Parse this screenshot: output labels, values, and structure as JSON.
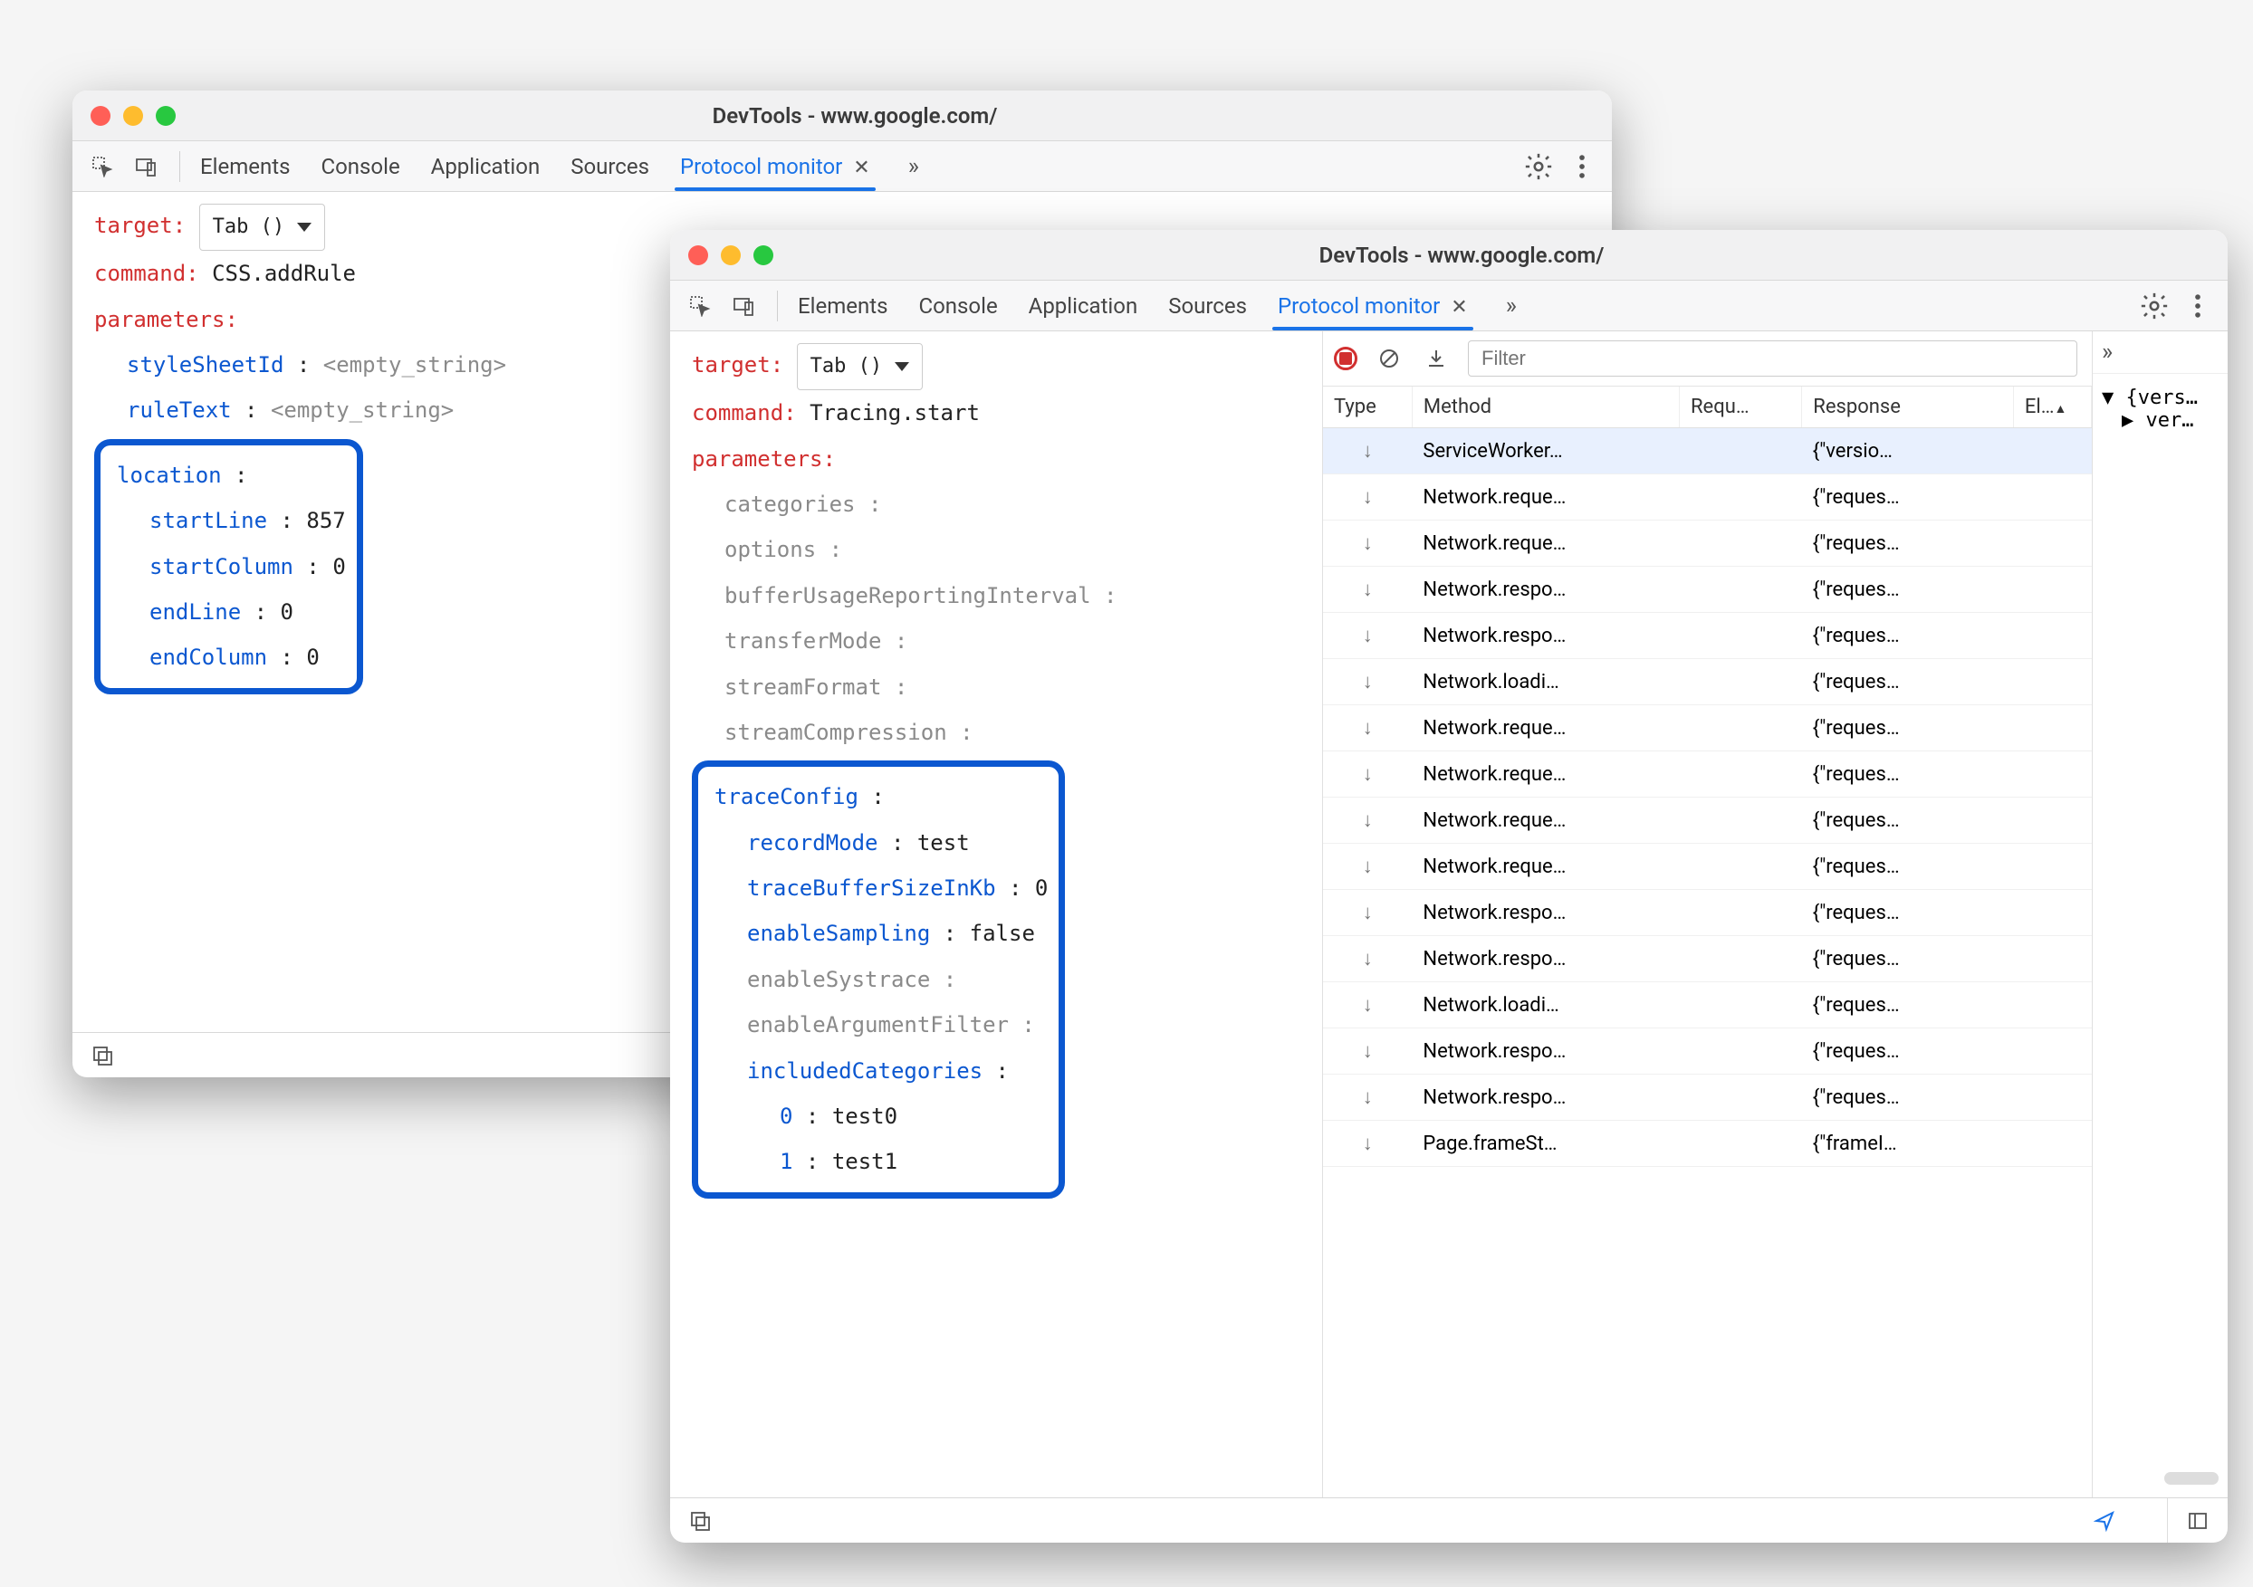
{
  "window1": {
    "title": "DevTools - www.google.com/",
    "tabs": [
      "Elements",
      "Console",
      "Application",
      "Sources",
      "Protocol monitor"
    ],
    "active_tab": "Protocol monitor",
    "target_label": "target",
    "target_value": "Tab ()",
    "command_label": "command",
    "command_value": "CSS.addRule",
    "parameters_label": "parameters",
    "params": [
      {
        "name": "styleSheetId",
        "value": "<empty_string>",
        "style": "gray"
      },
      {
        "name": "ruleText",
        "value": "<empty_string>",
        "style": "gray"
      }
    ],
    "highlight": {
      "header": "location",
      "rows": [
        {
          "name": "startLine",
          "value": "857"
        },
        {
          "name": "startColumn",
          "value": "0"
        },
        {
          "name": "endLine",
          "value": "0"
        },
        {
          "name": "endColumn",
          "value": "0"
        }
      ]
    }
  },
  "window2": {
    "title": "DevTools - www.google.com/",
    "tabs": [
      "Elements",
      "Console",
      "Application",
      "Sources",
      "Protocol monitor"
    ],
    "active_tab": "Protocol monitor",
    "target_label": "target",
    "target_value": "Tab ()",
    "command_label": "command",
    "command_value": "Tracing.start",
    "parameters_label": "parameters",
    "params": [
      {
        "name": "categories",
        "value": "",
        "style": "gray"
      },
      {
        "name": "options",
        "value": "",
        "style": "gray"
      },
      {
        "name": "bufferUsageReportingInterval",
        "value": "",
        "style": "gray"
      },
      {
        "name": "transferMode",
        "value": "",
        "style": "gray"
      },
      {
        "name": "streamFormat",
        "value": "",
        "style": "gray"
      },
      {
        "name": "streamCompression",
        "value": "",
        "style": "gray"
      }
    ],
    "highlight": {
      "header": "traceConfig",
      "rows": [
        {
          "name": "recordMode",
          "value": "test",
          "style": "blue"
        },
        {
          "name": "traceBufferSizeInKb",
          "value": "0",
          "style": "blue"
        },
        {
          "name": "enableSampling",
          "value": "false",
          "style": "blue"
        },
        {
          "name": "enableSystrace",
          "value": "",
          "style": "gray"
        },
        {
          "name": "enableArgumentFilter",
          "value": "",
          "style": "gray"
        },
        {
          "name": "includedCategories",
          "value": "",
          "style": "blue"
        }
      ],
      "array_rows": [
        {
          "name": "0",
          "value": "test0"
        },
        {
          "name": "1",
          "value": "test1"
        }
      ]
    },
    "filter_placeholder": "Filter",
    "columns": [
      "Type",
      "Method",
      "Requ…",
      "Response",
      "El…"
    ],
    "rows": [
      {
        "method": "ServiceWorker…",
        "response": "{\"versio…",
        "selected": true
      },
      {
        "method": "Network.reque…",
        "response": "{\"reques…"
      },
      {
        "method": "Network.reque…",
        "response": "{\"reques…"
      },
      {
        "method": "Network.respo…",
        "response": "{\"reques…"
      },
      {
        "method": "Network.respo…",
        "response": "{\"reques…"
      },
      {
        "method": "Network.loadi…",
        "response": "{\"reques…"
      },
      {
        "method": "Network.reque…",
        "response": "{\"reques…"
      },
      {
        "method": "Network.reque…",
        "response": "{\"reques…"
      },
      {
        "method": "Network.reque…",
        "response": "{\"reques…"
      },
      {
        "method": "Network.reque…",
        "response": "{\"reques…"
      },
      {
        "method": "Network.respo…",
        "response": "{\"reques…"
      },
      {
        "method": "Network.respo…",
        "response": "{\"reques…"
      },
      {
        "method": "Network.loadi…",
        "response": "{\"reques…"
      },
      {
        "method": "Network.respo…",
        "response": "{\"reques…"
      },
      {
        "method": "Network.respo…",
        "response": "{\"reques…"
      },
      {
        "method": "Page.frameSt…",
        "response": "{\"frameI…"
      }
    ],
    "rightpane": {
      "chevron": "»",
      "tree": [
        {
          "label": "{vers…",
          "disclosed": true
        },
        {
          "label": "ver…",
          "disclosed": false
        }
      ]
    },
    "sort_col": "El…"
  }
}
